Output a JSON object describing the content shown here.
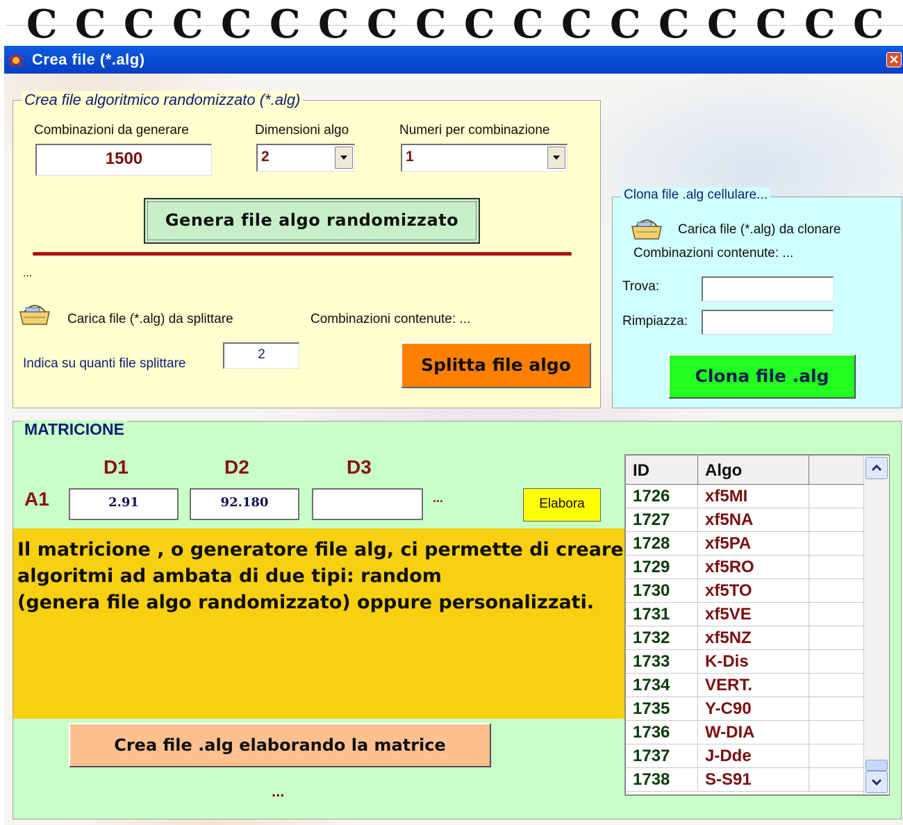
{
  "window": {
    "title": "Crea file (*.alg)",
    "close_glyph": "✕"
  },
  "random_section": {
    "legend": "Crea file algoritmico randomizzato (*.alg)",
    "combinations_label": "Combinazioni da generare",
    "combinations_value": "1500",
    "dimensions_label": "Dimensioni algo",
    "dimensions_value": "2",
    "numbers_label": "Numeri per combinazione",
    "numbers_value": "1",
    "generate_button": "Genera file algo randomizzato",
    "status_text": "...",
    "load_split_label": "Carica file (*.alg) da splittare",
    "split_combinations_label": "Combinazioni contenute: ...",
    "split_count_label": "Indica su quanti file splittare",
    "split_count_value": "2",
    "split_button": "Splitta file algo"
  },
  "clone_section": {
    "legend": "Clona file .alg cellulare...",
    "load_label": "Carica file (*.alg) da clonare",
    "combinations_label": "Combinazioni contenute: ...",
    "find_label": "Trova:",
    "find_value": "",
    "replace_label": "Rimpiazza:",
    "replace_value": "",
    "clone_button": "Clona file .alg"
  },
  "matrix_section": {
    "legend": "MATRICIONE",
    "col_headers": [
      "D1",
      "D2",
      "D3"
    ],
    "row_label": "A1",
    "cells": [
      "2.91",
      "92.180",
      ""
    ],
    "more": "...",
    "process_button": "Elabora",
    "info_text": [
      "Il matricione , o generatore file alg, ci permette di creare",
      "algoritmi ad ambata di due tipi: random",
      "(genera file algo randomizzato) oppure personalizzati."
    ],
    "create_button": "Crea file .alg elaborando la matrice",
    "status_text": "..."
  },
  "algo_grid": {
    "headers": [
      "ID",
      "Algo"
    ],
    "rows": [
      {
        "id": "1726",
        "algo": "xf5MI"
      },
      {
        "id": "1727",
        "algo": "xf5NA"
      },
      {
        "id": "1728",
        "algo": "xf5PA"
      },
      {
        "id": "1729",
        "algo": "xf5RO"
      },
      {
        "id": "1730",
        "algo": "xf5TO"
      },
      {
        "id": "1731",
        "algo": "xf5VE"
      },
      {
        "id": "1732",
        "algo": "xf5NZ"
      },
      {
        "id": "1733",
        "algo": "K-Dis"
      },
      {
        "id": "1734",
        "algo": "VERT."
      },
      {
        "id": "1735",
        "algo": "Y-C90"
      },
      {
        "id": "1736",
        "algo": "W-DIA"
      },
      {
        "id": "1737",
        "algo": "J-Dde"
      },
      {
        "id": "1738",
        "algo": "S-S91"
      }
    ]
  },
  "colors": {
    "titlebar": "#0a4fd8",
    "yellow_panel": "#ffffd0",
    "cyan_panel": "#d0ffff",
    "green_panel": "#c8ffc8",
    "generate_button": "#c8f0c8",
    "split_button": "#ff8000",
    "clone_button": "#20ff20",
    "process_button": "#ffff00",
    "create_button": "#ffc090",
    "info_box": "#f8d010",
    "dark_red": "#8a1010"
  },
  "icons": [
    "notebook-ring-icon",
    "app-icon",
    "close-icon",
    "basket-icon",
    "chevron-down-icon",
    "chevron-up-icon"
  ]
}
